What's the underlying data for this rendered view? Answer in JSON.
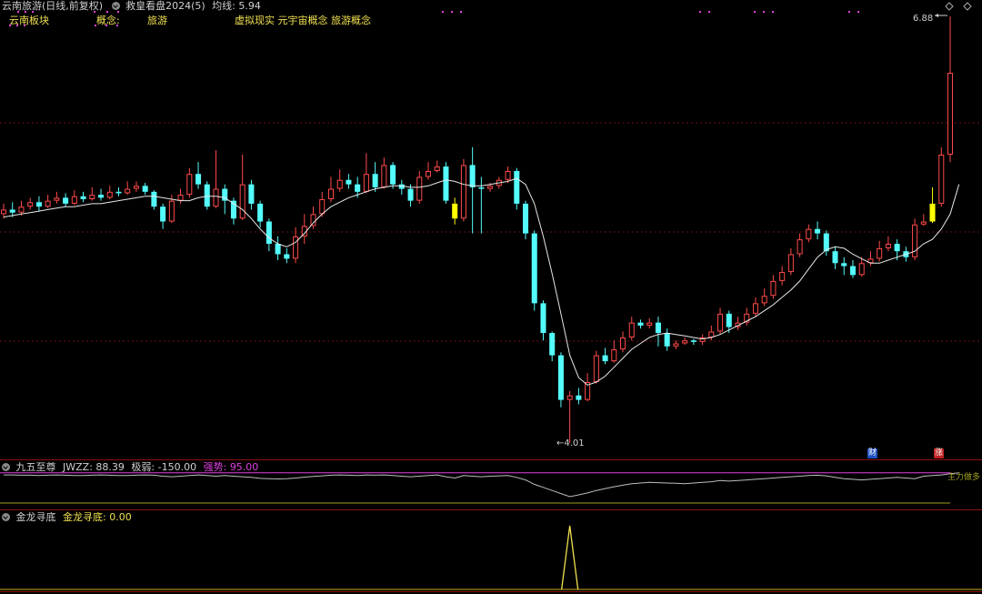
{
  "header": {
    "stock_title": "云南旅游(日线,前复权)",
    "indicator_name": "救皇看盘2024(5)",
    "ma_label": "均线:",
    "ma_value": "5.94"
  },
  "concept_row": {
    "sector_label": "云南板块",
    "concept_label": "概念:",
    "concept_value": "旅游",
    "tags": "虚拟现实  元宇宙概念  旅游概念"
  },
  "price_annotations": {
    "high_label": "6.88",
    "low_label": "←4.01"
  },
  "panel1": {
    "name": "九五至尊",
    "jwzz_label": "JWZZ:",
    "jwzz_value": "88.39",
    "extreme_label": "极弱:",
    "extreme_value": "-150.00",
    "strong_label": "强势:",
    "strong_value": "95.00",
    "right_label": "主力做多"
  },
  "panel2": {
    "name": "金龙寻底",
    "value_label": "金龙寻底:",
    "value": "0.00"
  },
  "badges": {
    "cai": "财",
    "zhang": "涨"
  },
  "colors": {
    "up": "#ff4a4a",
    "down": "#54fcfc",
    "signal": "#ffff00",
    "ma": "#e8e8e8",
    "grid": "#6e1010",
    "magenta": "#e040e0",
    "olive": "#a0a020",
    "panel_border": "#8a1010"
  },
  "chart_data": {
    "type": "candlestick",
    "price_high": 6.88,
    "price_low": 4.01,
    "candles": [
      [
        5.55,
        5.58,
        5.62,
        5.52
      ],
      [
        5.58,
        5.56,
        5.63,
        5.53
      ],
      [
        5.56,
        5.6,
        5.64,
        5.54
      ],
      [
        5.6,
        5.63,
        5.66,
        5.58
      ],
      [
        5.63,
        5.6,
        5.67,
        5.57
      ],
      [
        5.6,
        5.64,
        5.68,
        5.59
      ],
      [
        5.64,
        5.66,
        5.7,
        5.62
      ],
      [
        5.66,
        5.62,
        5.69,
        5.6
      ],
      [
        5.62,
        5.67,
        5.71,
        5.61
      ],
      [
        5.67,
        5.65,
        5.7,
        5.63
      ],
      [
        5.65,
        5.68,
        5.73,
        5.64
      ],
      [
        5.68,
        5.66,
        5.72,
        5.64
      ],
      [
        5.66,
        5.7,
        5.74,
        5.65
      ],
      [
        5.7,
        5.69,
        5.73,
        5.67
      ],
      [
        5.69,
        5.72,
        5.77,
        5.68
      ],
      [
        5.72,
        5.74,
        5.77,
        5.7
      ],
      [
        5.74,
        5.7,
        5.76,
        5.68
      ],
      [
        5.7,
        5.6,
        5.71,
        5.58
      ],
      [
        5.6,
        5.5,
        5.62,
        5.45
      ],
      [
        5.5,
        5.64,
        5.68,
        5.49
      ],
      [
        5.64,
        5.68,
        5.72,
        5.62
      ],
      [
        5.68,
        5.82,
        5.86,
        5.66
      ],
      [
        5.82,
        5.75,
        5.9,
        5.72
      ],
      [
        5.75,
        5.6,
        5.77,
        5.58
      ],
      [
        5.6,
        5.72,
        5.98,
        5.59
      ],
      [
        5.72,
        5.64,
        5.75,
        5.55
      ],
      [
        5.64,
        5.52,
        5.66,
        5.48
      ],
      [
        5.52,
        5.75,
        5.95,
        5.51
      ],
      [
        5.75,
        5.62,
        5.78,
        5.58
      ],
      [
        5.62,
        5.5,
        5.64,
        5.46
      ],
      [
        5.5,
        5.35,
        5.52,
        5.3
      ],
      [
        5.35,
        5.28,
        5.4,
        5.24
      ],
      [
        5.28,
        5.25,
        5.32,
        5.22
      ],
      [
        5.25,
        5.4,
        5.46,
        5.22
      ],
      [
        5.4,
        5.47,
        5.55,
        5.35
      ],
      [
        5.47,
        5.55,
        5.6,
        5.45
      ],
      [
        5.55,
        5.65,
        5.7,
        5.53
      ],
      [
        5.65,
        5.72,
        5.8,
        5.63
      ],
      [
        5.72,
        5.78,
        5.85,
        5.7
      ],
      [
        5.78,
        5.75,
        5.82,
        5.72
      ],
      [
        5.75,
        5.7,
        5.8,
        5.66
      ],
      [
        5.7,
        5.82,
        5.96,
        5.69
      ],
      [
        5.82,
        5.73,
        5.9,
        5.7
      ],
      [
        5.73,
        5.88,
        5.93,
        5.72
      ],
      [
        5.88,
        5.75,
        5.9,
        5.72
      ],
      [
        5.75,
        5.72,
        5.78,
        5.68
      ],
      [
        5.72,
        5.64,
        5.75,
        5.6
      ],
      [
        5.64,
        5.8,
        5.84,
        5.62
      ],
      [
        5.8,
        5.84,
        5.9,
        5.78
      ],
      [
        5.84,
        5.87,
        5.91,
        5.83
      ],
      [
        5.87,
        5.64,
        5.9,
        5.62
      ],
      [
        5.62,
        5.52,
        5.66,
        5.48
      ],
      [
        5.52,
        5.88,
        5.92,
        5.5
      ],
      [
        5.88,
        5.73,
        6.0,
        5.42
      ],
      [
        5.73,
        5.72,
        5.8,
        5.42
      ],
      [
        5.72,
        5.74,
        5.76,
        5.7
      ],
      [
        5.74,
        5.78,
        5.8,
        5.72
      ],
      [
        5.78,
        5.84,
        5.87,
        5.76
      ],
      [
        5.84,
        5.62,
        5.86,
        5.58
      ],
      [
        5.62,
        5.42,
        5.64,
        5.38
      ],
      [
        5.42,
        4.95,
        5.44,
        4.9
      ],
      [
        4.95,
        4.75,
        4.97,
        4.7
      ],
      [
        4.75,
        4.6,
        4.76,
        4.56
      ],
      [
        4.6,
        4.3,
        4.62,
        4.25
      ],
      [
        4.3,
        4.33,
        4.36,
        4.01
      ],
      [
        4.33,
        4.3,
        4.38,
        4.27
      ],
      [
        4.3,
        4.42,
        4.48,
        4.29
      ],
      [
        4.42,
        4.6,
        4.63,
        4.41
      ],
      [
        4.6,
        4.56,
        4.65,
        4.54
      ],
      [
        4.56,
        4.64,
        4.7,
        4.55
      ],
      [
        4.64,
        4.72,
        4.76,
        4.62
      ],
      [
        4.72,
        4.82,
        4.86,
        4.7
      ],
      [
        4.82,
        4.8,
        4.84,
        4.78
      ],
      [
        4.8,
        4.82,
        4.85,
        4.78
      ],
      [
        4.82,
        4.75,
        4.86,
        4.66
      ],
      [
        4.75,
        4.66,
        4.78,
        4.63
      ],
      [
        4.66,
        4.68,
        4.7,
        4.64
      ],
      [
        4.68,
        4.7,
        4.72,
        4.67
      ],
      [
        4.7,
        4.69,
        4.71,
        4.67
      ],
      [
        4.69,
        4.72,
        4.74,
        4.67
      ],
      [
        4.72,
        4.76,
        4.8,
        4.7
      ],
      [
        4.76,
        4.88,
        4.92,
        4.74
      ],
      [
        4.88,
        4.79,
        4.9,
        4.75
      ],
      [
        4.79,
        4.82,
        4.86,
        4.77
      ],
      [
        4.82,
        4.88,
        4.92,
        4.8
      ],
      [
        4.88,
        4.95,
        4.99,
        4.86
      ],
      [
        4.95,
        5.0,
        5.05,
        4.93
      ],
      [
        5.0,
        5.1,
        5.14,
        4.98
      ],
      [
        5.1,
        5.16,
        5.2,
        5.07
      ],
      [
        5.16,
        5.28,
        5.32,
        5.14
      ],
      [
        5.28,
        5.38,
        5.42,
        5.26
      ],
      [
        5.38,
        5.45,
        5.48,
        5.36
      ],
      [
        5.45,
        5.42,
        5.5,
        5.38
      ],
      [
        5.42,
        5.3,
        5.44,
        5.27
      ],
      [
        5.3,
        5.22,
        5.33,
        5.18
      ],
      [
        5.22,
        5.2,
        5.26,
        5.14
      ],
      [
        5.2,
        5.14,
        5.24,
        5.12
      ],
      [
        5.14,
        5.22,
        5.26,
        5.13
      ],
      [
        5.22,
        5.25,
        5.3,
        5.2
      ],
      [
        5.25,
        5.32,
        5.37,
        5.23
      ],
      [
        5.32,
        5.35,
        5.4,
        5.3
      ],
      [
        5.35,
        5.3,
        5.38,
        5.24
      ],
      [
        5.3,
        5.26,
        5.33,
        5.23
      ],
      [
        5.26,
        5.48,
        5.52,
        5.24
      ],
      [
        5.48,
        5.5,
        5.55,
        5.47
      ],
      [
        5.5,
        5.62,
        5.73,
        5.49
      ],
      [
        5.62,
        5.95,
        6.0,
        5.6
      ],
      [
        5.95,
        6.5,
        6.88,
        5.9
      ]
    ],
    "ma": [
      5.53,
      5.54,
      5.55,
      5.56,
      5.57,
      5.58,
      5.59,
      5.6,
      5.6,
      5.61,
      5.62,
      5.62,
      5.63,
      5.64,
      5.65,
      5.66,
      5.67,
      5.67,
      5.66,
      5.65,
      5.64,
      5.64,
      5.66,
      5.67,
      5.67,
      5.66,
      5.62,
      5.58,
      5.52,
      5.45,
      5.39,
      5.35,
      5.33,
      5.36,
      5.42,
      5.49,
      5.55,
      5.6,
      5.63,
      5.66,
      5.68,
      5.7,
      5.72,
      5.73,
      5.74,
      5.74,
      5.73,
      5.73,
      5.74,
      5.76,
      5.78,
      5.77,
      5.75,
      5.74,
      5.74,
      5.75,
      5.76,
      5.77,
      5.79,
      5.75,
      5.62,
      5.4,
      5.15,
      4.88,
      4.6,
      4.45,
      4.4,
      4.42,
      4.46,
      4.52,
      4.58,
      4.64,
      4.68,
      4.72,
      4.74,
      4.75,
      4.74,
      4.73,
      4.72,
      4.71,
      4.72,
      4.74,
      4.77,
      4.8,
      4.83,
      4.86,
      4.9,
      4.94,
      4.99,
      5.04,
      5.1,
      5.18,
      5.26,
      5.31,
      5.33,
      5.32,
      5.28,
      5.25,
      5.22,
      5.22,
      5.24,
      5.26,
      5.28,
      5.3,
      5.35,
      5.38,
      5.45,
      5.55,
      5.75
    ],
    "signal_bars": [
      51,
      105
    ],
    "jwzz": [
      88,
      88,
      87,
      87,
      86,
      87,
      88,
      87,
      86,
      86,
      87,
      88,
      87,
      86,
      86,
      87,
      88,
      87,
      84,
      82,
      84,
      86,
      88,
      86,
      84,
      86,
      84,
      82,
      80,
      77,
      76,
      75,
      76,
      78,
      81,
      83,
      85,
      87,
      88,
      87,
      86,
      88,
      87,
      88,
      86,
      84,
      82,
      84,
      86,
      88,
      82,
      78,
      86,
      84,
      82,
      84,
      85,
      86,
      80,
      72,
      58,
      48,
      38,
      28,
      18,
      24,
      30,
      38,
      44,
      50,
      55,
      60,
      62,
      64,
      63,
      62,
      61,
      60,
      62,
      64,
      66,
      70,
      68,
      70,
      72,
      74,
      76,
      78,
      80,
      82,
      84,
      86,
      87,
      85,
      80,
      76,
      74,
      72,
      74,
      76,
      78,
      80,
      78,
      76,
      84,
      86,
      88,
      92,
      95
    ],
    "extreme_weak": -150,
    "strong": 95,
    "jinlong": {
      "peak_index": 64,
      "peak_value": 100,
      "base": 0
    }
  }
}
